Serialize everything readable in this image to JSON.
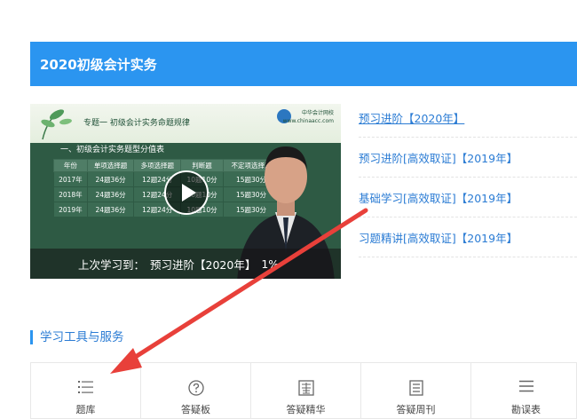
{
  "header": {
    "title": "2020初级会计实务"
  },
  "video": {
    "topic_title": "专题一 初级会计实务命题规律",
    "brand_cn": "中华会计网校",
    "brand_url": "www.chinaacc.com",
    "table_title": "一、初级会计实务题型分值表",
    "table": {
      "headers": [
        "年份",
        "单项选择题",
        "多项选择题",
        "判断题",
        "不定项选择题"
      ],
      "rows": [
        [
          "2017年",
          "24题36分",
          "12题24分",
          "10题10分",
          "15题30分"
        ],
        [
          "2018年",
          "24题36分",
          "12题24分",
          "10题10分",
          "15题30分"
        ],
        [
          "2019年",
          "24题36分",
          "12题24分",
          "10题10分",
          "15题30分"
        ]
      ]
    },
    "resume_label": "上次学习到：",
    "resume_course": "预习进阶【2020年】",
    "resume_progress": "1%"
  },
  "courses": [
    {
      "label": "预习进阶【2020年】"
    },
    {
      "label": "预习进阶[高效取证]【2019年】"
    },
    {
      "label": "基础学习[高效取证]【2019年】"
    },
    {
      "label": "习题精讲[高效取证]【2019年】"
    }
  ],
  "section": {
    "title": "学习工具与服务"
  },
  "tools": [
    {
      "label": "题库",
      "icon": "list-icon"
    },
    {
      "label": "答疑板",
      "icon": "question-icon"
    },
    {
      "label": "答疑精华",
      "icon": "essence-icon"
    },
    {
      "label": "答疑周刊",
      "icon": "document-icon"
    },
    {
      "label": "勘误表",
      "icon": "menu-icon"
    }
  ],
  "colors": {
    "accent": "#2b95f0",
    "link": "#2b7cd4",
    "arrow": "#e8403a"
  }
}
